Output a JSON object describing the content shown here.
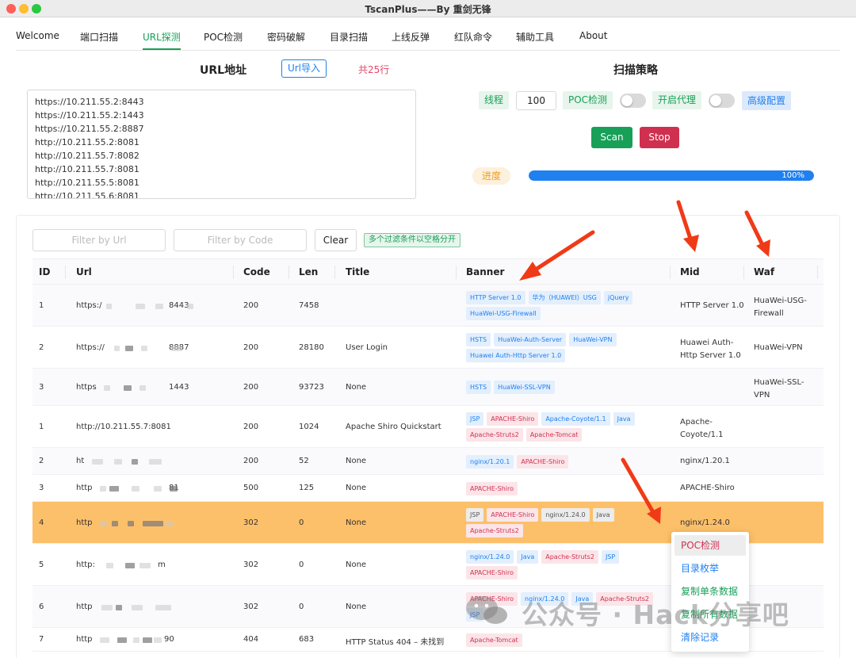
{
  "window": {
    "title": "TscanPlus——By 重剑无锋"
  },
  "nav": {
    "items": [
      "Welcome",
      "端口扫描",
      "URL探测",
      "POC检测",
      "密码破解",
      "目录扫描",
      "上线反弹",
      "红队命令",
      "辅助工具",
      "About"
    ],
    "active": "URL探测"
  },
  "url_panel": {
    "title": "URL地址",
    "import_label": "Url导入",
    "line_count": "共25行",
    "lines": [
      "https://10.211.55.2:8443",
      "https://10.211.55.2:1443",
      "https://10.211.55.2:8887",
      "http://10.211.55.2:8081",
      "http://10.211.55.7:8082",
      "http://10.211.55.7:8081",
      "http://10.211.55.5:8081",
      "http://10.211.55.6:8081"
    ]
  },
  "strategy": {
    "title": "扫描策略",
    "thread_label": "线程",
    "thread_value": "100",
    "poc_label": "POC检测",
    "proxy_label": "开启代理",
    "advanced_label": "高级配置",
    "poc_enabled": false,
    "proxy_enabled": false,
    "scan_label": "Scan",
    "stop_label": "Stop",
    "progress_label": "进度",
    "progress_percent": 100,
    "progress_text": "100%"
  },
  "filters": {
    "url_placeholder": "Filter by Url",
    "code_placeholder": "Filter by Code",
    "clear_label": "Clear",
    "hint": "多个过滤条件以空格分开"
  },
  "table": {
    "columns": [
      "ID",
      "Url",
      "Code",
      "Len",
      "Title",
      "Banner",
      "Mid",
      "Waf"
    ],
    "rows": [
      {
        "id": "1",
        "url_start": "https:/",
        "url_end": "8443",
        "code": "200",
        "len": "7458",
        "title": "",
        "banners": [
          [
            "HTTP Server 1.0",
            "blue"
          ],
          [
            "华为（HUAWEI）USG",
            "blue"
          ],
          [
            "jQuery",
            "blue"
          ],
          [
            "HuaWei-USG-Firewall",
            "blue"
          ]
        ],
        "mid": "HTTP Server 1.0",
        "waf": "HuaWei-USG-Firewall"
      },
      {
        "id": "2",
        "url_start": "https://",
        "url_end": "8887",
        "code": "200",
        "len": "28180",
        "title": "User Login",
        "banners": [
          [
            "HSTS",
            "blue"
          ],
          [
            "HuaWei-Auth-Server",
            "blue"
          ],
          [
            "HuaWei-VPN",
            "blue"
          ],
          [
            "Huawei Auth-Http Server 1.0",
            "blue"
          ]
        ],
        "mid": "Huawei Auth-Http Server 1.0",
        "waf": "HuaWei-VPN"
      },
      {
        "id": "3",
        "url_start": "https",
        "url_end": "1443",
        "code": "200",
        "len": "93723",
        "title": "None",
        "banners": [
          [
            "HSTS",
            "blue"
          ],
          [
            "HuaWei-SSL-VPN",
            "blue"
          ]
        ],
        "mid": "",
        "waf": "HuaWei-SSL-VPN"
      },
      {
        "id": "1",
        "url_start": "http://10.211.55.7:8081",
        "url_end": "",
        "code": "200",
        "len": "1024",
        "title": "Apache Shiro Quickstart",
        "banners": [
          [
            "JSP",
            "blue"
          ],
          [
            "APACHE-Shiro",
            "red"
          ],
          [
            "Apache-Coyote/1.1",
            "blue"
          ],
          [
            "Java",
            "blue"
          ],
          [
            "Apache-Struts2",
            "red"
          ],
          [
            "Apache-Tomcat",
            "red"
          ]
        ],
        "mid": "Apache-Coyote/1.1",
        "waf": ""
      },
      {
        "id": "2",
        "url_start": "ht",
        "url_end": "",
        "code": "200",
        "len": "52",
        "title": "None",
        "banners": [
          [
            "nginx/1.20.1",
            "blue"
          ],
          [
            "APACHE-Shiro",
            "red"
          ]
        ],
        "mid": "nginx/1.20.1",
        "waf": ""
      },
      {
        "id": "3",
        "url_start": "http",
        "url_end": "81",
        "code": "500",
        "len": "125",
        "title": "None",
        "banners": [
          [
            "APACHE-Shiro",
            "red"
          ]
        ],
        "mid": "APACHE-Shiro",
        "waf": ""
      },
      {
        "id": "4",
        "url_start": "http",
        "url_end": "",
        "code": "302",
        "len": "0",
        "title": "None",
        "banners": [
          [
            "JSP",
            "gray"
          ],
          [
            "APACHE-Shiro",
            "red"
          ],
          [
            "nginx/1.24.0",
            "gray"
          ],
          [
            "Java",
            "gray"
          ],
          [
            "Apache-Struts2",
            "red"
          ]
        ],
        "mid": "nginx/1.24.0",
        "waf": ""
      },
      {
        "id": "5",
        "url_start": "http:",
        "url_end": "m",
        "code": "302",
        "len": "0",
        "title": "None",
        "banners": [
          [
            "nginx/1.24.0",
            "blue"
          ],
          [
            "Java",
            "blue"
          ],
          [
            "Apache-Struts2",
            "red"
          ],
          [
            "JSP",
            "blue"
          ],
          [
            "APACHE-Shiro",
            "red"
          ]
        ],
        "mid": "",
        "waf": ""
      },
      {
        "id": "6",
        "url_start": "http",
        "url_end": "",
        "code": "302",
        "len": "0",
        "title": "None",
        "banners": [
          [
            "APACHE-Shiro",
            "red"
          ],
          [
            "nginx/1.24.0",
            "blue"
          ],
          [
            "Java",
            "blue"
          ],
          [
            "Apache-Struts2",
            "red"
          ],
          [
            "JSP",
            "blue"
          ]
        ],
        "mid": "",
        "waf": ""
      },
      {
        "id": "7",
        "url_start": "http",
        "url_end": "90",
        "code": "404",
        "len": "683",
        "title": "HTTP Status 404 – 未找到",
        "banners": [
          [
            "Apache-Tomcat",
            "red"
          ]
        ],
        "mid": "",
        "waf": ""
      }
    ],
    "highlighted_row": 6
  },
  "context_menu": {
    "items": [
      "POC检测",
      "目录枚举",
      "复制单条数据",
      "复制所有数据",
      "清除记录"
    ]
  },
  "watermark": {
    "text": "公众号 · Hack分享吧"
  },
  "colors": {
    "accent_green": "#18a058",
    "accent_blue": "#2080f0",
    "accent_red": "#d03050",
    "highlight_row": "#fdc06a",
    "annotation_arrow": "#f03a17"
  }
}
